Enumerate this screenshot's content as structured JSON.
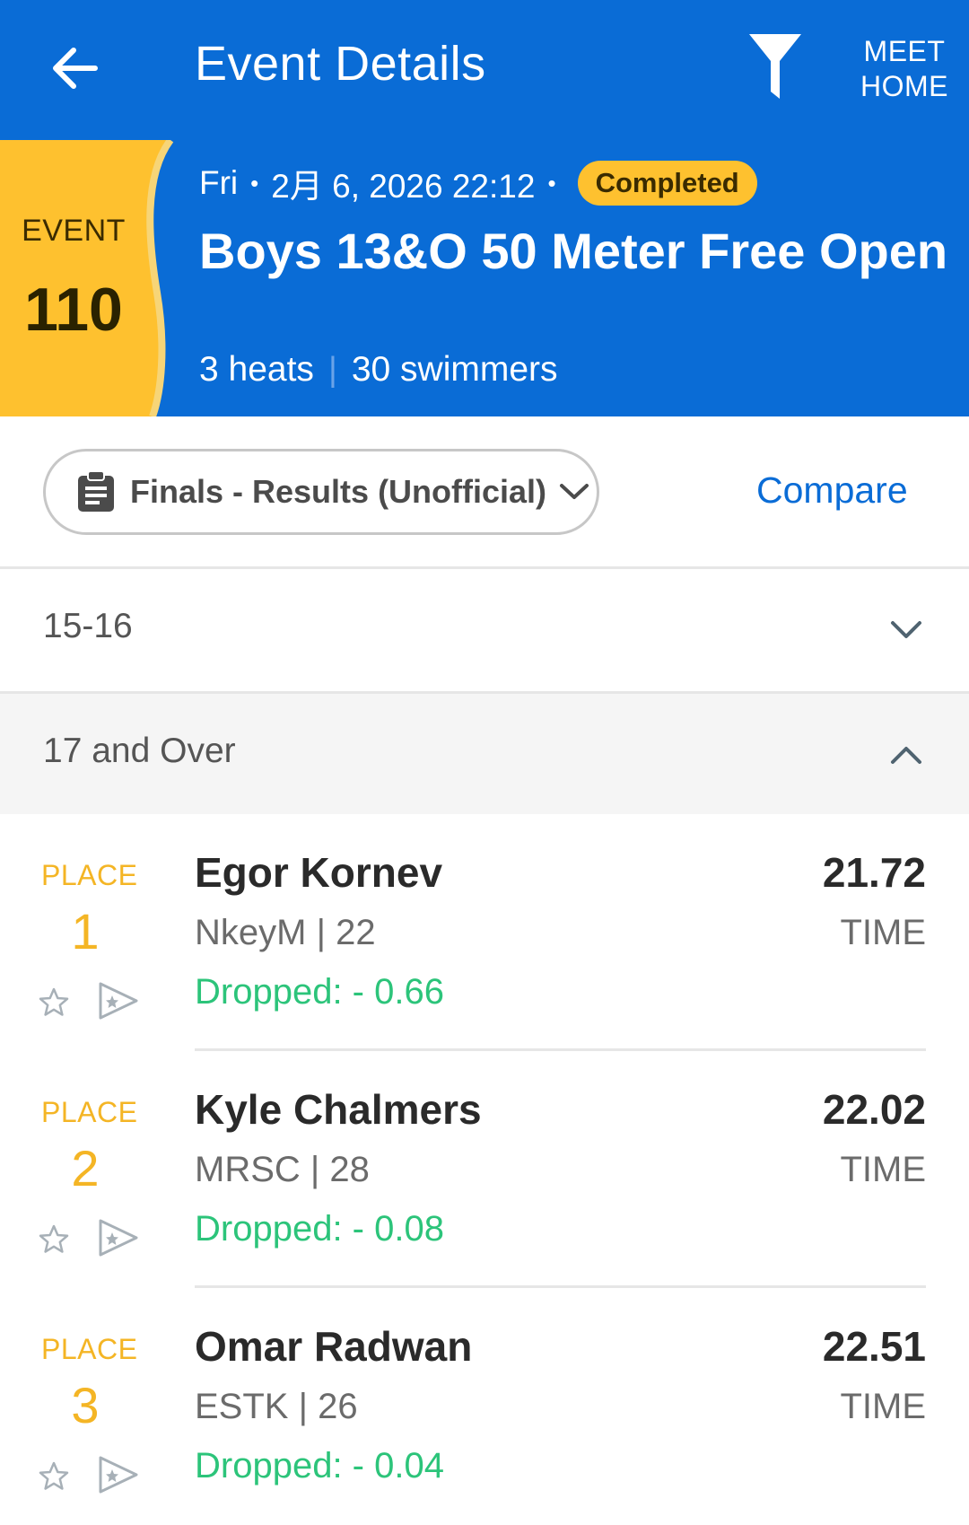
{
  "appbar": {
    "title": "Event Details",
    "meet_home_line1": "MEET",
    "meet_home_line2": "HOME"
  },
  "event": {
    "label": "EVENT",
    "number": "110",
    "day": "Fri",
    "datetime": "2月 6, 2026 22:12",
    "status": "Completed",
    "title": "Boys 13&O 50 Meter Free Open",
    "heats": "3 heats",
    "swimmers": "30 swimmers"
  },
  "controls": {
    "round": "Finals - Results (Unofficial)",
    "compare": "Compare"
  },
  "age_groups": [
    {
      "label": "15-16",
      "expanded": false
    },
    {
      "label": "17 and Over",
      "expanded": true
    }
  ],
  "results": [
    {
      "place_label": "PLACE",
      "place": "1",
      "name": "Egor Kornev",
      "team_age": "NkeyM | 22",
      "dropped": "Dropped: - 0.66",
      "time": "21.72",
      "time_label": "TIME"
    },
    {
      "place_label": "PLACE",
      "place": "2",
      "name": "Kyle Chalmers",
      "team_age": "MRSC | 28",
      "dropped": "Dropped: - 0.08",
      "time": "22.02",
      "time_label": "TIME"
    },
    {
      "place_label": "PLACE",
      "place": "3",
      "name": "Omar Radwan",
      "team_age": "ESTK | 26",
      "dropped": "Dropped: - 0.04",
      "time": "22.51",
      "time_label": "TIME"
    }
  ],
  "colors": {
    "primary": "#0a6cd6",
    "accent": "#fec12f",
    "place": "#f4b525",
    "dropped": "#2cc47a"
  },
  "icons": [
    "back-arrow-icon",
    "filter-icon",
    "clipboard-icon",
    "chevron-down-icon",
    "chevron-up-icon",
    "star-icon",
    "share-icon"
  ]
}
